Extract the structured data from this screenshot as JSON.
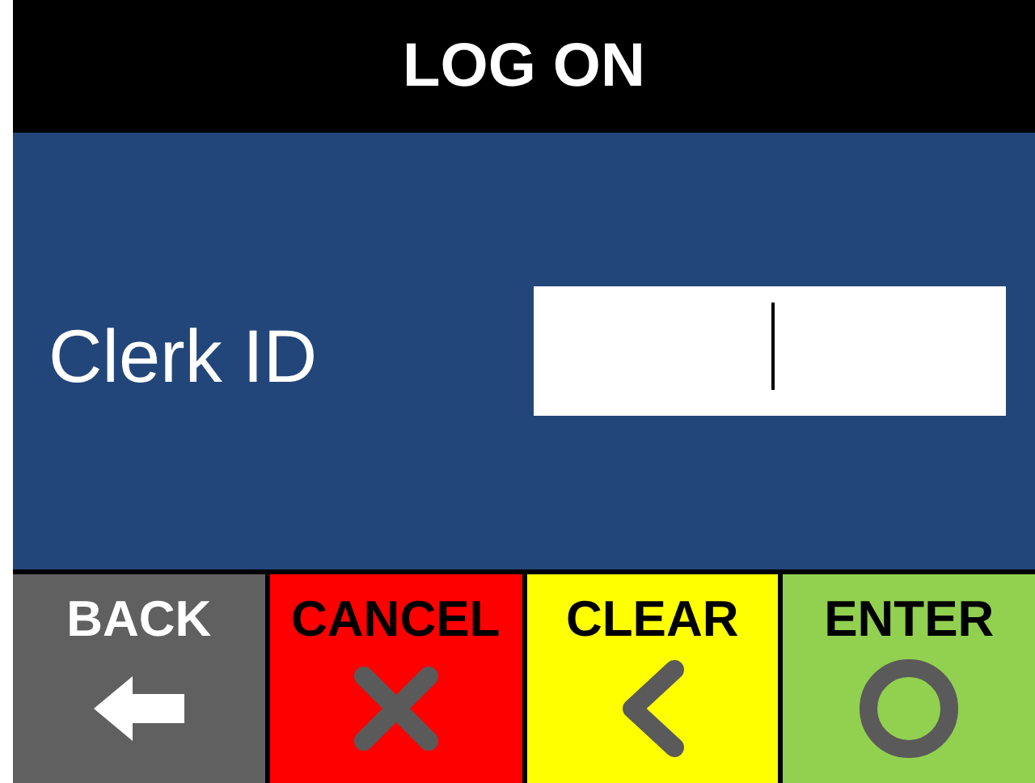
{
  "title_bar": {
    "title": "LOG ON"
  },
  "form": {
    "label": "Clerk ID",
    "cursor": true
  },
  "buttons": [
    {
      "label": "BACK",
      "color": "#606060",
      "kind": "arrow"
    },
    {
      "label": "CANCEL",
      "color": "#ff0000",
      "kind": "cross"
    },
    {
      "label": "CLEAR",
      "color": "#ffff00",
      "kind": "chevron"
    },
    {
      "label": "ENTER",
      "color": "#92d050",
      "kind": "ring"
    }
  ]
}
